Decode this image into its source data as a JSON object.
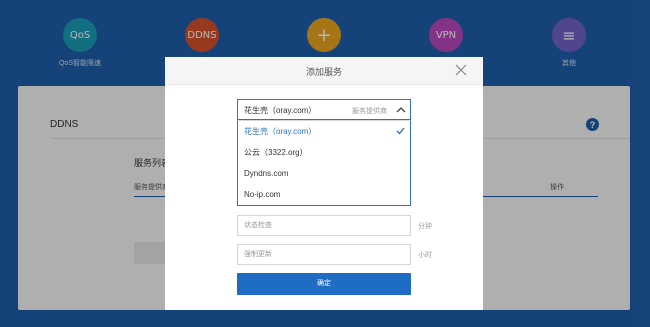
{
  "nav": {
    "items": [
      {
        "icon_text": "QoS",
        "label": "QoS智能限速",
        "color": "#1a9ab5",
        "icon": "qos-icon"
      },
      {
        "icon_text": "DDNS",
        "label": "",
        "color": "#d0502a",
        "icon": "ddns-icon"
      },
      {
        "icon_text": "+",
        "label": "",
        "color": "#e6a21f",
        "icon": "plus-icon"
      },
      {
        "icon_text": "VPN",
        "label": "",
        "color": "#b547b9",
        "icon": "vpn-icon"
      },
      {
        "icon_text": "≡",
        "label": "其他",
        "color": "#6f62c8",
        "icon": "menu-icon"
      }
    ]
  },
  "panel": {
    "title": "DDNS",
    "help": "?",
    "service_list_label": "服务列表",
    "service_col": "服务提供商",
    "op_col": "操作"
  },
  "modal": {
    "title": "添加服务",
    "select": {
      "value": "花生壳（oray.com）",
      "hint": "服务提供商"
    },
    "options": [
      {
        "label": "花生壳（oray.com）",
        "selected": true
      },
      {
        "label": "公云（3322.org）",
        "selected": false
      },
      {
        "label": "Dyndns.com",
        "selected": false
      },
      {
        "label": "No-ip.com",
        "selected": false
      }
    ],
    "status_check": {
      "placeholder": "状态检查",
      "unit": "分钟"
    },
    "force_update": {
      "placeholder": "强制更新",
      "unit": "小时"
    },
    "ok_label": "确定"
  },
  "colors": {
    "background": "#1e5ea8",
    "accent": "#2f72c4",
    "button": "#1e6cc4"
  }
}
